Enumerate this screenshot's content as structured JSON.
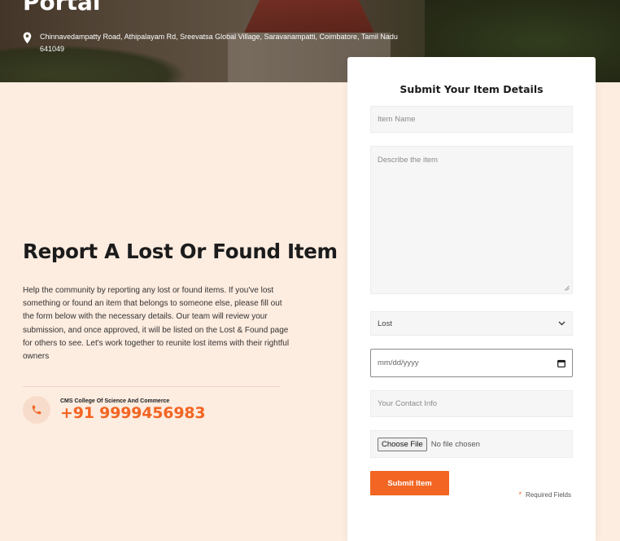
{
  "hero": {
    "title": "Portal",
    "address": "Chinnavedampatty Road, Athipalayam Rd, Sreevatsa Global Village, Saravanampatti, Coimbatore, Tamil Nadu 641049"
  },
  "main": {
    "heading": "Report A Lost Or Found Item",
    "description": "Help the community by reporting any lost or found items. If you've lost something or found an item that belongs to someone else, please fill out the form below with the necessary details. Our team will review your submission, and once approved, it will be listed on the Lost & Found page for others to see. Let's work together to reunite lost items with their rightful owners",
    "contact": {
      "organization": "CMS College Of Science And Commerce",
      "phone": "+91 9999456983"
    }
  },
  "form": {
    "title": "Submit Your Item Details",
    "item_name_placeholder": "Item Name",
    "description_placeholder": "Describe the item",
    "type_selected": "Lost",
    "date_placeholder": "mm/dd/yyyy",
    "contact_placeholder": "Your Contact Info",
    "file_button": "Choose File",
    "file_status": "No file chosen",
    "submit_label": "Submit Item",
    "required_star": "*",
    "required_label": "Required Fields"
  },
  "colors": {
    "accent": "#f26522",
    "page_background": "#fdece0"
  }
}
